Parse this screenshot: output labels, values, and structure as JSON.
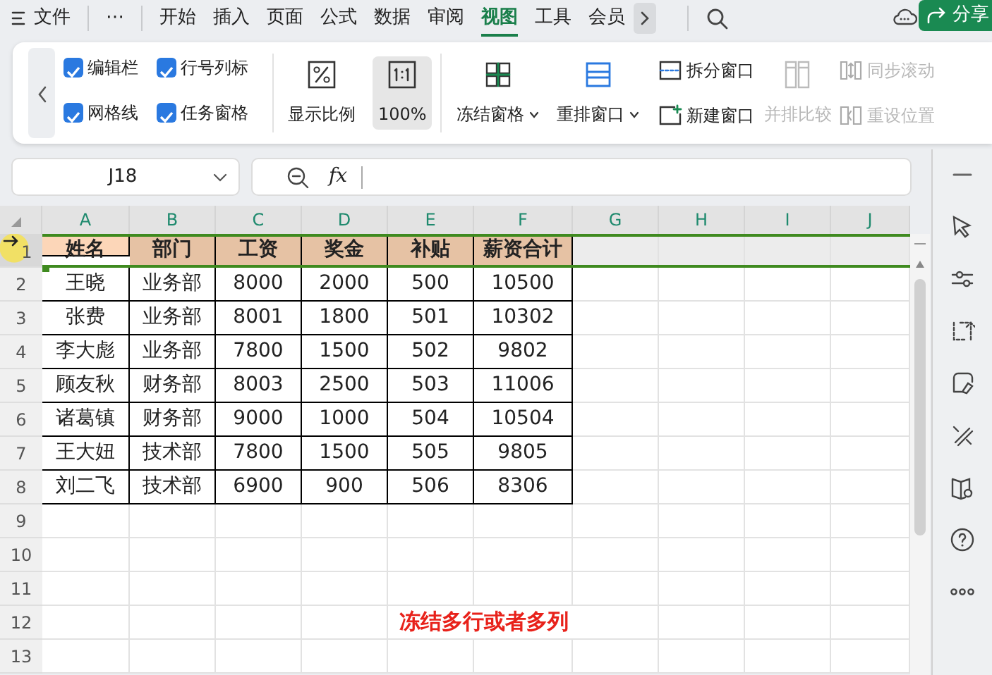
{
  "menu": {
    "file": "文件",
    "more": "⋯",
    "tabs": [
      {
        "label": "开始",
        "selected": false
      },
      {
        "label": "插入",
        "selected": false
      },
      {
        "label": "页面",
        "selected": false
      },
      {
        "label": "公式",
        "selected": false
      },
      {
        "label": "数据",
        "selected": false
      },
      {
        "label": "审阅",
        "selected": false
      },
      {
        "label": "视图",
        "selected": true
      },
      {
        "label": "工具",
        "selected": false
      },
      {
        "label": "会员",
        "selected": false
      }
    ],
    "share": "分享"
  },
  "ribbon": {
    "checkboxes": [
      {
        "label": "编辑栏",
        "checked": true
      },
      {
        "label": "网格线",
        "checked": true
      },
      {
        "label": "行号列标",
        "checked": true
      },
      {
        "label": "任务窗格",
        "checked": true
      }
    ],
    "large_buttons": [
      {
        "label": "显示比例",
        "kind": "zoom",
        "active": false,
        "dropdown": false
      },
      {
        "label": "100%",
        "kind": "actual",
        "active": true,
        "dropdown": false
      }
    ],
    "large_buttons_2": [
      {
        "label": "冻结窗格",
        "kind": "freeze",
        "active": false,
        "dropdown": true
      },
      {
        "label": "重排窗口",
        "kind": "arrange",
        "active": false,
        "dropdown": true
      }
    ],
    "small_buttons": [
      {
        "label": "拆分窗口",
        "kind": "split",
        "disabled": false
      },
      {
        "label": "新建窗口",
        "kind": "new",
        "disabled": false
      }
    ],
    "compare": {
      "label": "并排比较",
      "disabled": true
    },
    "small_buttons_2": [
      {
        "label": "同步滚动",
        "kind": "sync",
        "disabled": true
      },
      {
        "label": "重设位置",
        "kind": "reset",
        "disabled": true
      }
    ]
  },
  "name_box": "J18",
  "fx": "fx",
  "sheet": {
    "columns": [
      "A",
      "B",
      "C",
      "D",
      "E",
      "F",
      "G",
      "H",
      "I",
      "J"
    ],
    "rows": [
      {
        "number": "1",
        "header": true,
        "cells": [
          "姓名",
          "部门",
          "工资",
          "奖金",
          "补贴",
          "薪资合计"
        ]
      },
      {
        "number": "2",
        "cells": [
          "王晓",
          "业务部",
          "8000",
          "2000",
          "500",
          "10500"
        ]
      },
      {
        "number": "3",
        "cells": [
          "张费",
          "业务部",
          "8001",
          "1800",
          "501",
          "10302"
        ]
      },
      {
        "number": "4",
        "cells": [
          "李大彪",
          "业务部",
          "7800",
          "1500",
          "502",
          "9802"
        ]
      },
      {
        "number": "5",
        "cells": [
          "顾友秋",
          "财务部",
          "8003",
          "2500",
          "503",
          "11006"
        ]
      },
      {
        "number": "6",
        "cells": [
          "诸葛镇",
          "财务部",
          "9000",
          "1000",
          "504",
          "10504"
        ]
      },
      {
        "number": "7",
        "cells": [
          "王大妞",
          "技术部",
          "7800",
          "1500",
          "505",
          "9805"
        ]
      },
      {
        "number": "8",
        "cells": [
          "刘二飞",
          "技术部",
          "6900",
          "900",
          "506",
          "8306"
        ]
      },
      {
        "number": "9",
        "cells": []
      },
      {
        "number": "10",
        "cells": []
      },
      {
        "number": "11",
        "cells": []
      },
      {
        "number": "12",
        "cells": [],
        "caption": "冻结多行或者多列"
      },
      {
        "number": "13",
        "cells": []
      }
    ]
  }
}
